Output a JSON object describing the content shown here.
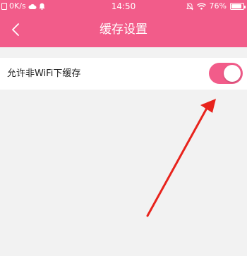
{
  "status_bar": {
    "network_speed": "0K/s",
    "time": "14:50",
    "battery_percent": "76%",
    "battery_level": 0.76
  },
  "nav": {
    "title": "缓存设置",
    "back_icon": "chevron-left-icon"
  },
  "settings": [
    {
      "label": "允许非WiFi下缓存",
      "enabled": true
    }
  ],
  "colors": {
    "header": "#f25c8a",
    "toggle_on": "#f25c8a",
    "background": "#f2f2f2",
    "annotation_arrow": "#e8231c"
  }
}
